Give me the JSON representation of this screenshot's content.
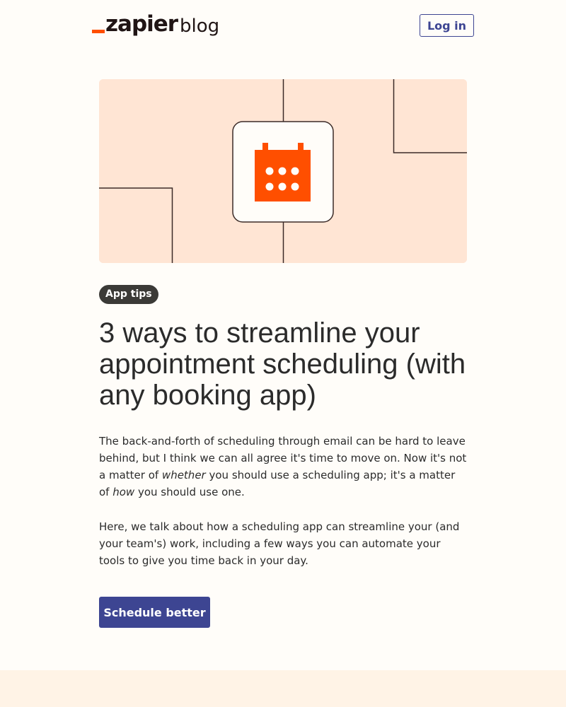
{
  "header": {
    "logo_word": "zapier",
    "logo_suffix": "blog",
    "login_label": "Log in"
  },
  "hero": {
    "icon": "calendar-icon",
    "background_color": "#ffe5d4",
    "icon_color": "#ff4f00"
  },
  "article": {
    "tag": "App tips",
    "title": "3 ways to streamline your appointment scheduling (with any booking app)",
    "paragraph1": {
      "part1": "The back-and-forth of scheduling through email can be hard to leave behind, but I think we can all agree it's time to move on. Now it's not a matter of ",
      "em1": "whether",
      "part2": " you should use a scheduling app; it's a matter of ",
      "em2": "how",
      "part3": " you should use one."
    },
    "paragraph2": "Here, we talk about how a scheduling app can streamline your (and your team's) work, including a few ways you can automate your tools to give you time back in your day.",
    "cta_label": "Schedule better"
  },
  "colors": {
    "accent": "#ff4f00",
    "primary": "#3d4592",
    "page_background": "#fffdf9",
    "footer_band": "#fff3e6"
  }
}
